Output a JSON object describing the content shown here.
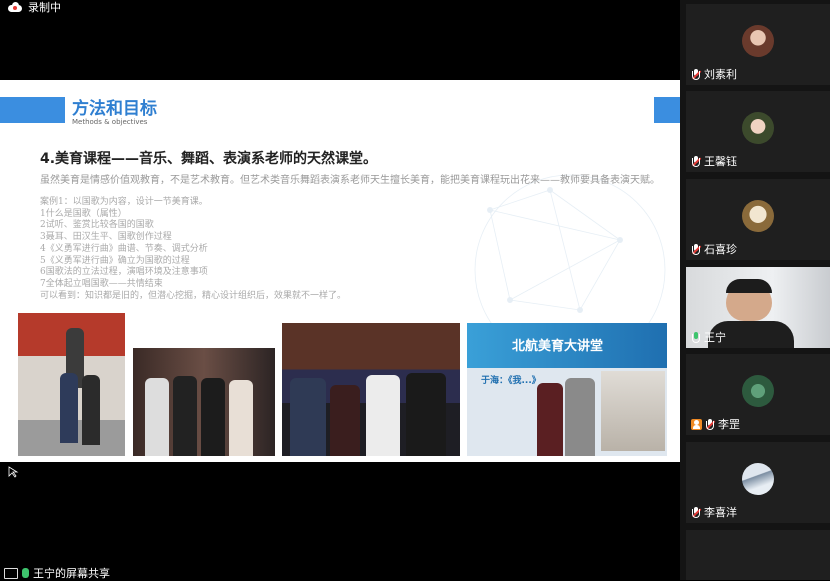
{
  "recording": {
    "label": "录制中"
  },
  "slide": {
    "title": "方法和目标",
    "subtitle": "Methods & objectives",
    "heading": "4.美育课程——音乐、舞蹈、表演系老师的天然课堂。",
    "intro": "虽然美育是情感价值观教育，不是艺术教育。但艺术类音乐舞蹈表演系老师天生擅长美育，能把美育课程玩出花来——教师要具备表演天赋。",
    "cases": [
      "案例1：以国歌为内容，设计一节美育课。",
      "1什么是国歌（属性）",
      "2试听、鉴赏比较各国的国歌",
      "3聂耳、田汉生平、国歌创作过程",
      "4《义勇军进行曲》曲谱、节奏、调式分析",
      "5《义勇军进行曲》确立为国歌的过程",
      "6国歌法的立法过程，演唱环境及注意事项",
      "7全体起立唱国歌——共情结束",
      "可以看到：知识都是旧的，但潜心挖掘，精心设计组织后，效果就不一样了。"
    ],
    "photo4": {
      "banner": "北航美育大讲堂",
      "caption": "于海：《我...》"
    }
  },
  "share_bar": {
    "label": "王宁的屏幕共享"
  },
  "participants": [
    {
      "name": "刘素利",
      "mic": "muted"
    },
    {
      "name": "王馨钰",
      "mic": "muted"
    },
    {
      "name": "石喜珍",
      "mic": "muted"
    },
    {
      "name": "王宁",
      "mic": "on",
      "active": true
    },
    {
      "name": "李罡",
      "mic": "muted",
      "host_icon": true
    },
    {
      "name": "李喜洋",
      "mic": "muted"
    }
  ],
  "colors": {
    "accent": "#3b8ee0",
    "speaking": "#3ec46d",
    "muted": "#e53935"
  }
}
